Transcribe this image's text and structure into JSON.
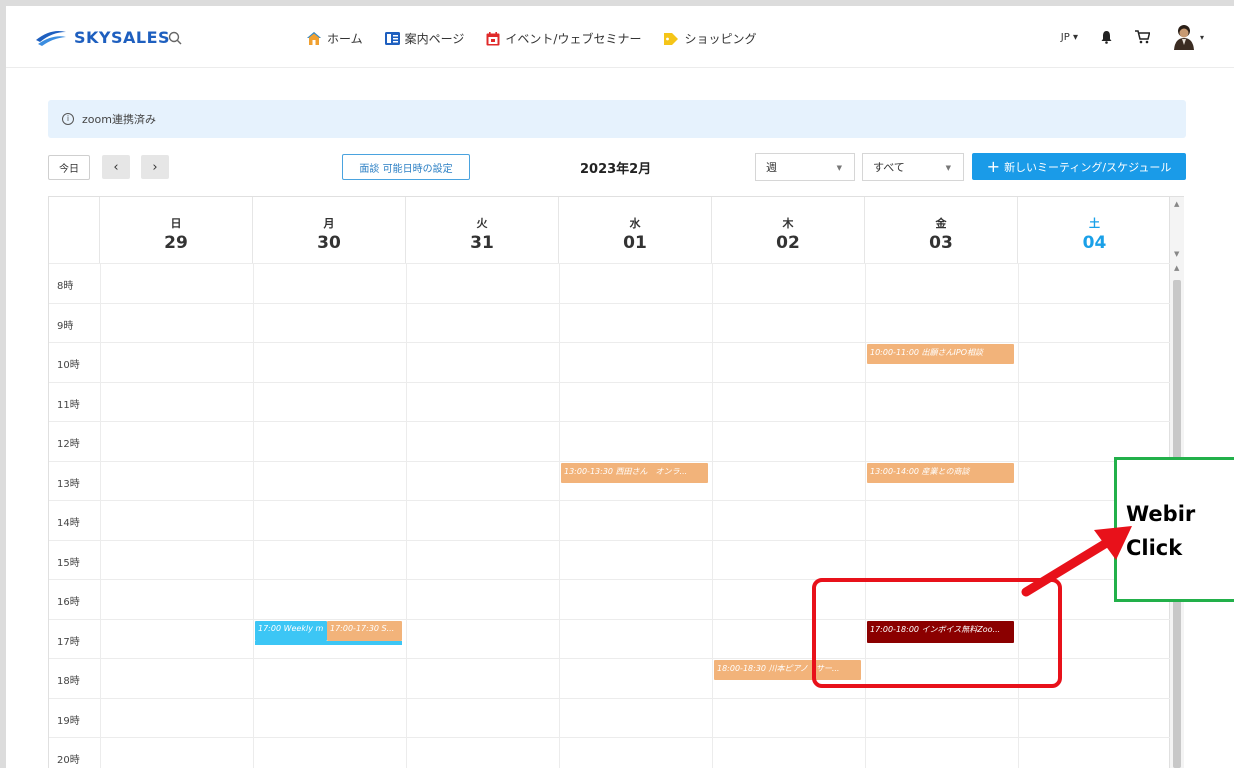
{
  "header": {
    "logo_text": "SKYSALES",
    "nav": [
      {
        "label": "ホーム",
        "icon": "home-icon"
      },
      {
        "label": "案内ページ",
        "icon": "guide-page-icon"
      },
      {
        "label": "イベント/ウェブセミナー",
        "icon": "calendar-icon"
      },
      {
        "label": "ショッピング",
        "icon": "tag-icon"
      }
    ],
    "lang": "JP ▾",
    "colors": {
      "brand": "#1e5fbf",
      "accent": "#1a9be8"
    }
  },
  "info": {
    "text": "zoom連携済み"
  },
  "toolbar": {
    "today": "今日",
    "prev": "‹",
    "next": "›",
    "availability": "面談 可能日時の設定",
    "month": "2023年2月",
    "view_select": "週",
    "filter_select": "すべて",
    "new_button": "新しいミーティング/スケジュール"
  },
  "calendar": {
    "days": [
      {
        "dow": "日",
        "num": "29"
      },
      {
        "dow": "月",
        "num": "30"
      },
      {
        "dow": "火",
        "num": "31"
      },
      {
        "dow": "水",
        "num": "01"
      },
      {
        "dow": "木",
        "num": "02"
      },
      {
        "dow": "金",
        "num": "03"
      },
      {
        "dow": "土",
        "num": "04"
      }
    ],
    "hours": [
      "8時",
      "9時",
      "10時",
      "11時",
      "12時",
      "13時",
      "14時",
      "15時",
      "16時",
      "17時",
      "18時",
      "19時",
      "20時"
    ],
    "events": [
      {
        "text": "10:00-11:00 出願さんIPO相談",
        "day": 5,
        "start": 10.0,
        "color": "orange"
      },
      {
        "text": "13:00-13:30 西田さん　オンラ...",
        "day": 3,
        "start": 13.0,
        "color": "orange"
      },
      {
        "text": "13:00-14:00 産業との商談",
        "day": 5,
        "start": 13.0,
        "color": "orange"
      },
      {
        "text": "17:00 Weekly m",
        "day": 1,
        "start": 17.0,
        "color": "blue"
      },
      {
        "text": "17:00-17:30 S...",
        "day": 1,
        "start": 17.0,
        "color": "orange"
      },
      {
        "text": "17:00-18:00 インボイス無料Zoo...",
        "day": 5,
        "start": 17.0,
        "color": "red"
      },
      {
        "text": "18:00-18:30 川本ピアノ　サー...",
        "day": 4,
        "start": 18.0,
        "color": "orange"
      }
    ]
  },
  "annotation": {
    "line1": "Webir",
    "line2": "Click"
  }
}
